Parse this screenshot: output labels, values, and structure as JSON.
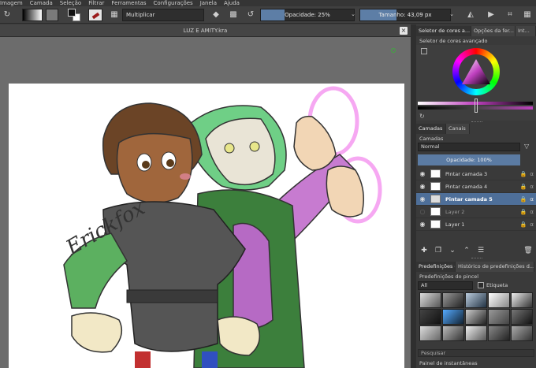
{
  "menu": [
    "Imagem",
    "Camada",
    "Seleção",
    "Filtrar",
    "Ferramentas",
    "Configurações",
    "Janela",
    "Ajuda"
  ],
  "toolbar": {
    "blend_mode": "Multiplicar",
    "opacity_label": "Opacidade: 25%",
    "opacity_value": 0.25,
    "size_label": "Tamanho: 43,09 px",
    "size_fill": 0.4
  },
  "document": {
    "title": "LUZ E AMITY.kra",
    "close": "×",
    "signature": "Erickfox"
  },
  "dock": {
    "top_tabs": [
      "Seletor de cores a...",
      "Opções da fer...",
      "Int..."
    ],
    "color_selector_title": "Seletor de cores avançado",
    "layer_tabs": [
      "Camadas",
      "Canais"
    ],
    "layers_title": "Camadas",
    "blend_mode": "Normal",
    "opacity_label": "Opacidade:  100%",
    "layers": [
      {
        "name": "Pintar camada 3",
        "visible": true
      },
      {
        "name": "Pintar camada 4",
        "visible": true
      },
      {
        "name": "Pintar camada 5",
        "visible": true,
        "selected": true
      },
      {
        "name": "Layer 2",
        "visible": false
      },
      {
        "name": "Layer 1",
        "visible": true
      }
    ],
    "preset_tabs": [
      "Predefinições d...",
      "Histórico de predefinições d..."
    ],
    "brush_presets_title": "Predefinições do pincel",
    "preset_filter": "All",
    "tag_label": "Etiqueta",
    "search_placeholder": "Pesquisar",
    "snapshot_title": "Painel de instantâneas"
  },
  "colors": {
    "accent": "#5d7ea6",
    "selected_layer": "#4e6f99"
  }
}
